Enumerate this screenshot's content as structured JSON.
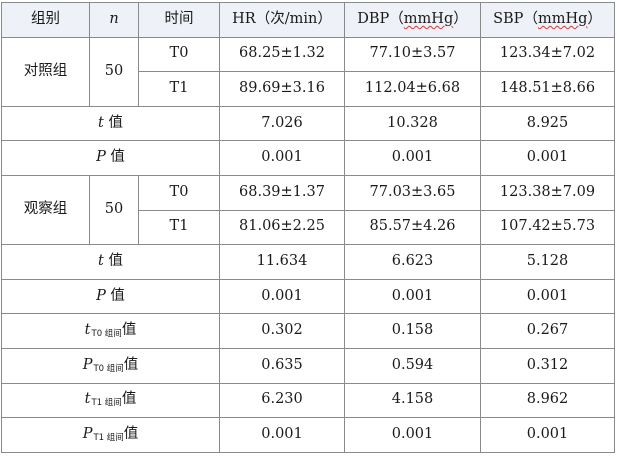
{
  "header": {
    "group": "组别",
    "n": "n",
    "time": "时间",
    "hr": "HR（次/min）",
    "dbp_prefix": "DBP（",
    "dbp_unit": "mmHg",
    "dbp_suffix": "）",
    "sbp_prefix": "SBP（",
    "sbp_unit": "mmHg",
    "sbp_suffix": "）"
  },
  "control": {
    "name": "对照组",
    "n": "50",
    "rows": [
      {
        "time": "T0",
        "hr": "68.25±1.32",
        "dbp": "77.10±3.57",
        "sbp": "123.34±7.02"
      },
      {
        "time": "T1",
        "hr": "89.69±3.16",
        "dbp": "112.04±6.68",
        "sbp": "148.51±8.66"
      }
    ],
    "t": {
      "sym": "t",
      "label": " 值",
      "hr": "7.026",
      "dbp": "10.328",
      "sbp": "8.925"
    },
    "p": {
      "sym": "P",
      "label": " 值",
      "hr": "0.001",
      "dbp": "0.001",
      "sbp": "0.001"
    }
  },
  "observe": {
    "name": "观察组",
    "n": "50",
    "rows": [
      {
        "time": "T0",
        "hr": "68.39±1.37",
        "dbp": "77.03±3.65",
        "sbp": "123.38±7.09"
      },
      {
        "time": "T1",
        "hr": "81.06±2.25",
        "dbp": "85.57±4.26",
        "sbp": "107.42±5.73"
      }
    ],
    "t": {
      "sym": "t",
      "label": " 值",
      "hr": "11.634",
      "dbp": "6.623",
      "sbp": "5.128"
    },
    "p": {
      "sym": "P",
      "label": " 值",
      "hr": "0.001",
      "dbp": "0.001",
      "sbp": "0.001"
    }
  },
  "between": [
    {
      "sym": "t",
      "sub": "T0 组间",
      "label": "值",
      "hr": "0.302",
      "dbp": "0.158",
      "sbp": "0.267"
    },
    {
      "sym": "P",
      "sub": "T0 组间",
      "label": "值",
      "hr": "0.635",
      "dbp": "0.594",
      "sbp": "0.312"
    },
    {
      "sym": "t",
      "sub": "T1 组间",
      "label": "值",
      "hr": "6.230",
      "dbp": "4.158",
      "sbp": "8.962"
    },
    {
      "sym": "P",
      "sub": "T1 组间",
      "label": "值",
      "hr": "0.001",
      "dbp": "0.001",
      "sbp": "0.001"
    }
  ]
}
